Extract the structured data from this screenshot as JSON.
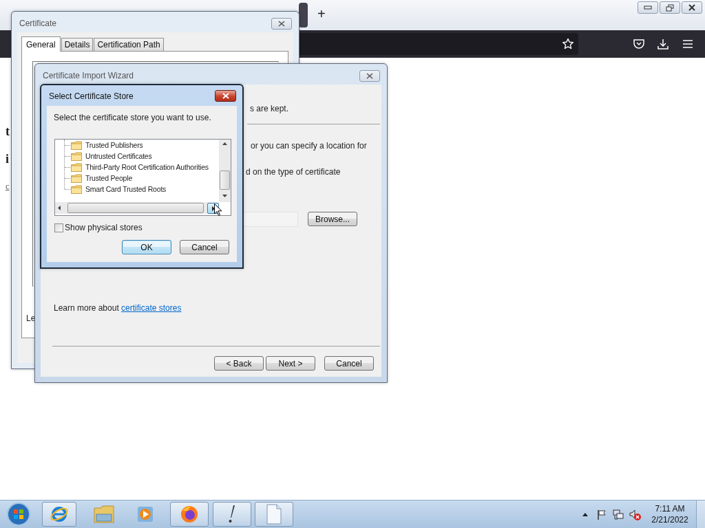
{
  "browser": {
    "new_tab": "+",
    "page_fragments": [
      {
        "kind": "heading",
        "text": "t"
      },
      {
        "kind": "heading",
        "text": "i"
      },
      {
        "kind": "link",
        "text": "c"
      }
    ]
  },
  "certificate_window": {
    "title": "Certificate",
    "tabs": [
      {
        "label": "General",
        "selected": true
      },
      {
        "label": "Details",
        "selected": false
      },
      {
        "label": "Certification Path",
        "selected": false
      }
    ],
    "footer_fragment": "Le"
  },
  "import_wizard": {
    "title": "Certificate Import Wizard",
    "text_fragments": [
      "s are kept.",
      "or you can specify a location for",
      "d on the type of certificate"
    ],
    "browse_button": "Browse...",
    "learn_more": {
      "text": "Learn more about",
      "link": "certificate stores"
    },
    "buttons": [
      "< Back",
      "Next >",
      "Cancel"
    ]
  },
  "select_store_dialog": {
    "title": "Select Certificate Store",
    "prompt": "Select the certificate store you want to use.",
    "stores": [
      {
        "name": "Trusted Publishers",
        "selected": false
      },
      {
        "name": "Untrusted Certificates",
        "selected": false
      },
      {
        "name": "Third-Party Root Certification Authorities",
        "selected": false
      },
      {
        "name": "Trusted People",
        "selected": false
      },
      {
        "name": "Smart Card Trusted Roots",
        "selected": false
      }
    ],
    "show_physical_stores": {
      "label": "Show physical stores",
      "checked": false
    },
    "buttons": [
      {
        "label": "OK",
        "default": true
      },
      {
        "label": "Cancel",
        "default": false
      }
    ]
  },
  "taskbar": {
    "clock": {
      "time": "7:11 AM",
      "date": "2/21/2022"
    }
  }
}
